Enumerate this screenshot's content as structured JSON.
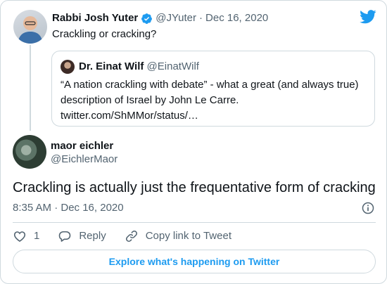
{
  "colors": {
    "twitter_blue": "#1d9bf0",
    "secondary_text": "#536471",
    "border": "#cfd9de",
    "primary_text": "#0f1419"
  },
  "parent_tweet": {
    "name": "Rabbi Josh Yuter",
    "handle": "@JYuter",
    "separator": "·",
    "date": "Dec 16, 2020",
    "text": "Crackling or cracking?",
    "verified_icon": "verified-badge-icon"
  },
  "quoted_tweet": {
    "name": "Dr. Einat Wilf",
    "handle": "@EinatWilf",
    "lines": [
      "“A nation crackling with debate” - what a great (and always true)",
      "description of Israel by John Le Carre.",
      "twitter.com/ShMMor/status/…"
    ]
  },
  "main_tweet": {
    "name": "maor eichler",
    "handle": "@EichlerMaor",
    "text": "Crackling is actually just the frequentative form of cracking",
    "timestamp": "8:35 AM · Dec 16, 2020"
  },
  "actions": {
    "like_count": "1",
    "reply_label": "Reply",
    "copy_link_label": "Copy link to Tweet"
  },
  "explore_button": "Explore what's happening on Twitter",
  "icons": [
    "twitter-bird-icon",
    "verified-badge-icon",
    "info-icon",
    "heart-icon",
    "reply-icon",
    "link-icon"
  ]
}
